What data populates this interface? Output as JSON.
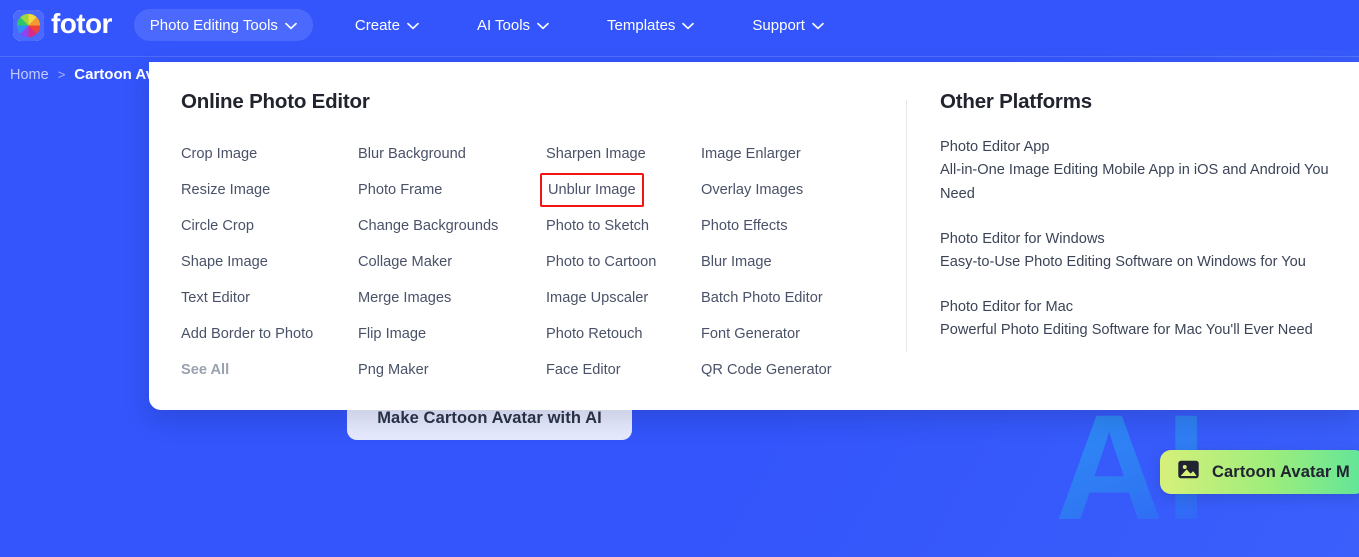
{
  "brand": {
    "name": "fotor",
    "logo_icon": "color-wheel-icon"
  },
  "nav": {
    "items": [
      {
        "label": "Photo Editing Tools",
        "icon": "chevron-down-icon",
        "active": true
      },
      {
        "label": "Create",
        "icon": "chevron-down-icon",
        "active": false
      },
      {
        "label": "AI Tools",
        "icon": "chevron-down-icon",
        "active": false
      },
      {
        "label": "Templates",
        "icon": "chevron-down-icon",
        "active": false
      },
      {
        "label": "Support",
        "icon": "chevron-down-icon",
        "active": false
      }
    ]
  },
  "breadcrumb": {
    "home": "Home",
    "separator": ">",
    "current": "Cartoon Av"
  },
  "mega_menu": {
    "left_title": "Online Photo Editor",
    "columns": [
      {
        "links": [
          {
            "label": "Crop Image",
            "highlighted": false,
            "muted": false
          },
          {
            "label": "Resize Image",
            "highlighted": false,
            "muted": false
          },
          {
            "label": "Circle Crop",
            "highlighted": false,
            "muted": false
          },
          {
            "label": "Shape Image",
            "highlighted": false,
            "muted": false
          },
          {
            "label": "Text Editor",
            "highlighted": false,
            "muted": false
          },
          {
            "label": "Add Border to Photo",
            "highlighted": false,
            "muted": false
          },
          {
            "label": "See All",
            "highlighted": false,
            "muted": true
          }
        ]
      },
      {
        "links": [
          {
            "label": "Blur Background",
            "highlighted": false,
            "muted": false
          },
          {
            "label": "Photo Frame",
            "highlighted": false,
            "muted": false
          },
          {
            "label": "Change Backgrounds",
            "highlighted": false,
            "muted": false
          },
          {
            "label": "Collage Maker",
            "highlighted": false,
            "muted": false
          },
          {
            "label": "Merge Images",
            "highlighted": false,
            "muted": false
          },
          {
            "label": "Flip Image",
            "highlighted": false,
            "muted": false
          },
          {
            "label": "Png Maker",
            "highlighted": false,
            "muted": false
          }
        ]
      },
      {
        "links": [
          {
            "label": "Sharpen Image",
            "highlighted": false,
            "muted": false
          },
          {
            "label": "Unblur Image",
            "highlighted": true,
            "muted": false
          },
          {
            "label": "Photo to Sketch",
            "highlighted": false,
            "muted": false
          },
          {
            "label": "Photo to Cartoon",
            "highlighted": false,
            "muted": false
          },
          {
            "label": "Image Upscaler",
            "highlighted": false,
            "muted": false
          },
          {
            "label": "Photo Retouch",
            "highlighted": false,
            "muted": false
          },
          {
            "label": "Face Editor",
            "highlighted": false,
            "muted": false
          }
        ]
      },
      {
        "links": [
          {
            "label": "Image Enlarger",
            "highlighted": false,
            "muted": false
          },
          {
            "label": "Overlay Images",
            "highlighted": false,
            "muted": false
          },
          {
            "label": "Photo Effects",
            "highlighted": false,
            "muted": false
          },
          {
            "label": "Blur Image",
            "highlighted": false,
            "muted": false
          },
          {
            "label": "Batch Photo Editor",
            "highlighted": false,
            "muted": false
          },
          {
            "label": "Font Generator",
            "highlighted": false,
            "muted": false
          },
          {
            "label": "QR Code Generator",
            "highlighted": false,
            "muted": false
          }
        ]
      }
    ],
    "right_title": "Other Platforms",
    "platforms": [
      {
        "name": "Photo Editor App",
        "description": "All-in-One Image Editing Mobile App in iOS and Android You Need"
      },
      {
        "name": "Photo Editor for Windows",
        "description": "Easy-to-Use Photo Editing Software on Windows for You"
      },
      {
        "name": "Photo Editor for Mac",
        "description": "Powerful Photo Editing Software for Mac You'll Ever Need"
      }
    ]
  },
  "hero": {
    "cta_label": "Make Cartoon Avatar with AI",
    "watermark_text": "AI",
    "badge": {
      "icon": "image-icon",
      "label": "Cartoon Avatar M"
    }
  },
  "colors": {
    "brand_blue": "#3355fb",
    "nav_active_blue": "#4b69fc",
    "highlight_red": "#f41414",
    "menu_bg": "#ffffff",
    "link_text": "#4a5268",
    "muted_text": "#9aa1b0",
    "badge_green_start": "#d6f07a",
    "badge_green_end": "#5fe59a",
    "watermark_blue": "#2f8ff5"
  }
}
